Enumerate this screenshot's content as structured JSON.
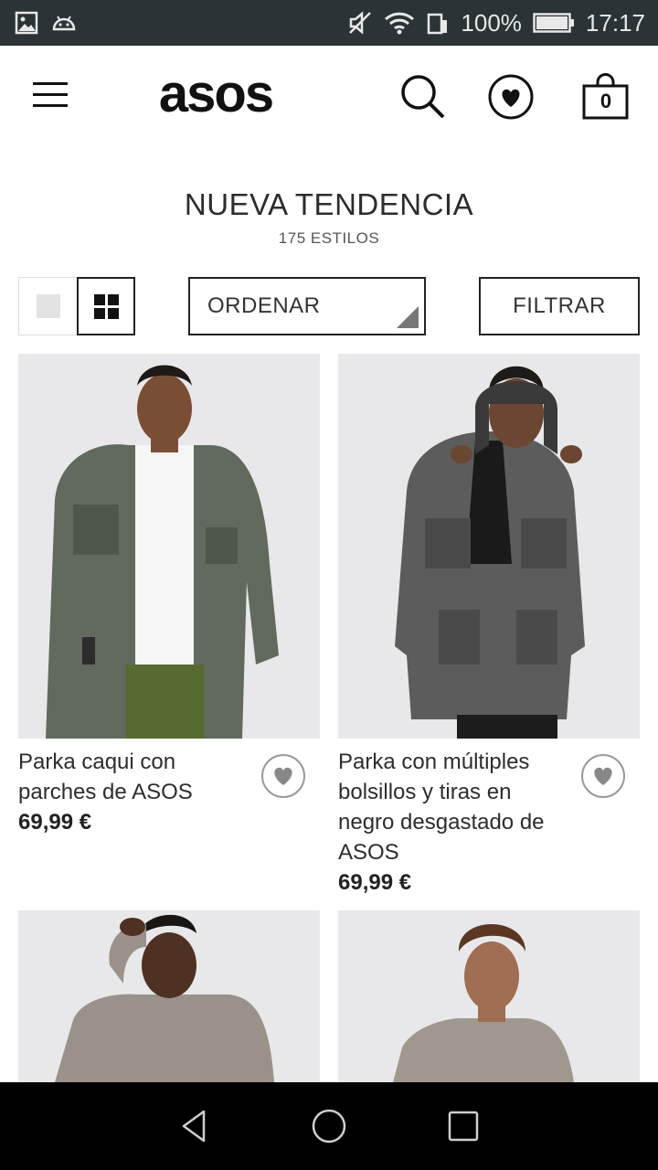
{
  "status_bar": {
    "battery": "100%",
    "time": "17:17"
  },
  "app": {
    "logo_text": "asos",
    "bag_count": "0"
  },
  "listing": {
    "title": "NUEVA TENDENCIA",
    "count": "175 ESTILOS"
  },
  "controls": {
    "sort_label": "ORDENAR",
    "filter_label": "FILTRAR"
  },
  "products": [
    {
      "name": "Parka caqui con parches de ASOS",
      "price": "69,99 €"
    },
    {
      "name": "Parka con múltiples bolsillos y tiras en negro desgastado de ASOS",
      "price": "69,99 €"
    }
  ],
  "colors": {
    "status_bar_bg": "#2a3336",
    "accent": "#111111",
    "nav_bar_bg": "#000000"
  }
}
